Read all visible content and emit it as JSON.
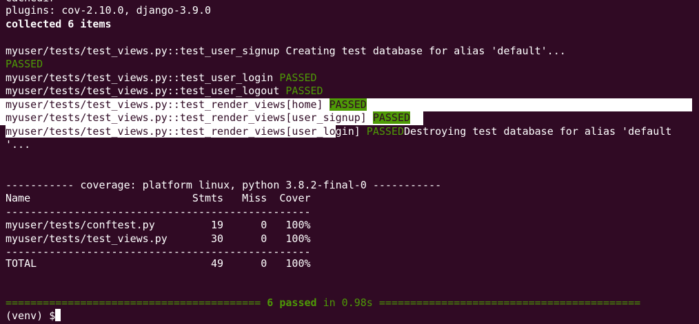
{
  "terminal": {
    "lines": {
      "partial_top": "cachedir",
      "plugins": "plugins: cov-2.10.0, django-3.9.0",
      "collected": "collected 6 items",
      "test1": "myuser/tests/test_views.py::test_user_signup Creating test database for alias 'default'...",
      "test1_result": "PASSED",
      "test2": "myuser/tests/test_views.py::test_user_login ",
      "test2_result": "PASSED",
      "test3": "myuser/tests/test_views.py::test_user_logout ",
      "test3_result": "PASSED",
      "test4": "myuser/tests/test_views.py::test_render_views[home] ",
      "test4_result": "PASSED",
      "test5": "myuser/tests/test_views.py::test_render_views[user_signup] ",
      "test5_result": "PASSED",
      "test6_sel": "myuser/tests/test_views.py::test_render_views[user_lo",
      "test6_rest": "gin] ",
      "test6_result": "PASSED",
      "test6_after": "Destroying test database for alias 'default",
      "test6_wrap": "'...",
      "coverage_header": "----------- coverage: platform linux, python 3.8.2-final-0 -----------",
      "cov_cols": "Name                          Stmts   Miss  Cover",
      "sep": "-------------------------------------------------",
      "cov_row1": "myuser/tests/conftest.py         19      0   100%",
      "cov_row2": "myuser/tests/test_views.py       30      0   100%",
      "total": "TOTAL                            49      0   100%",
      "summary_left": "========================================= ",
      "summary_passed": "6 passed",
      "summary_time": " in 0.98s ",
      "summary_right": "==========================================",
      "prompt": "(venv) $"
    }
  }
}
